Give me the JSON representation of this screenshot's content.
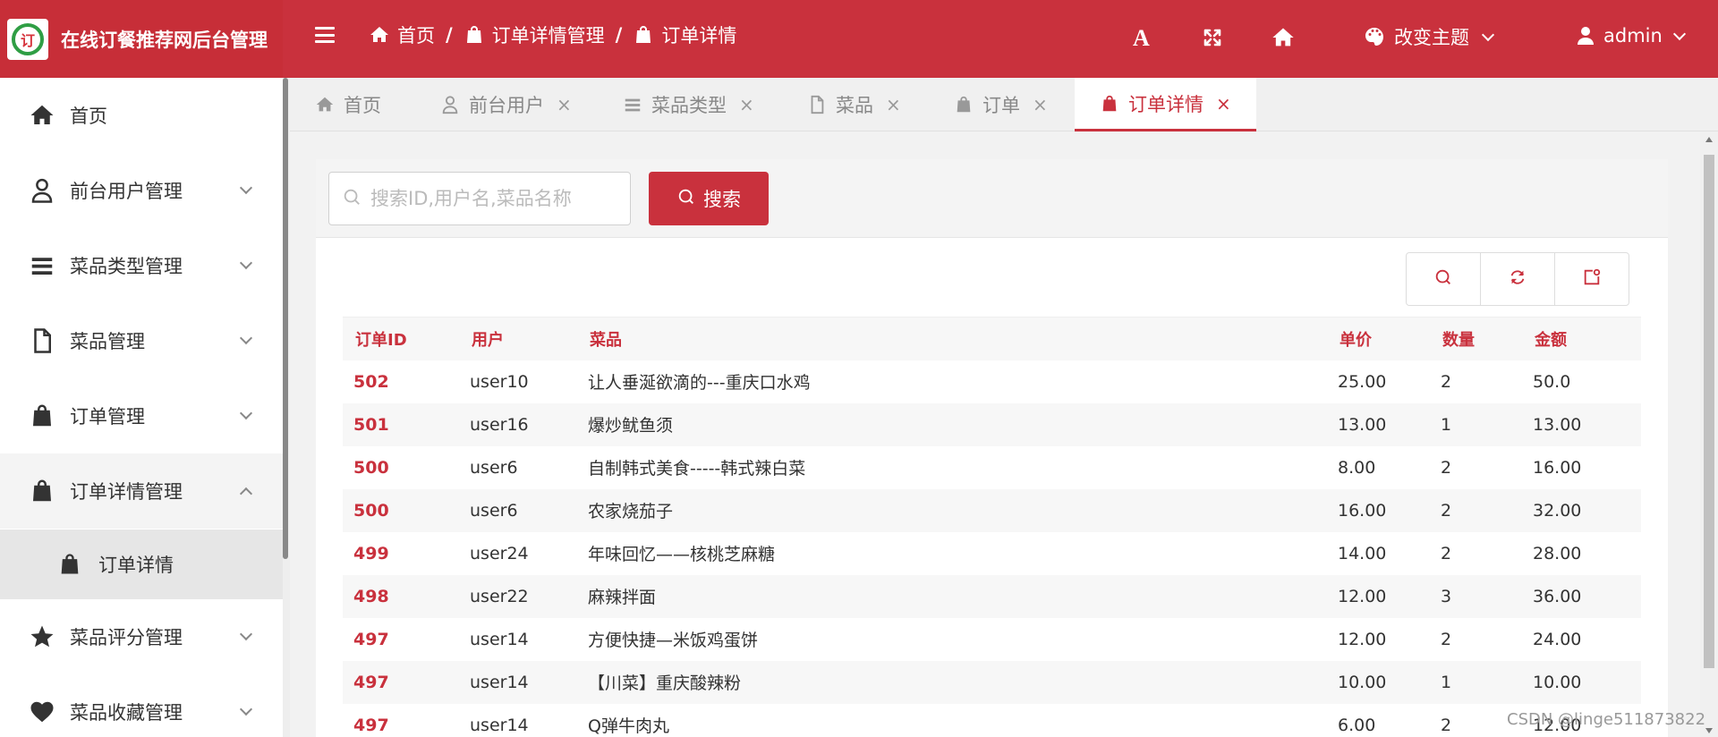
{
  "app": {
    "title": "在线订餐推荐网后台管理"
  },
  "header": {
    "breadcrumb": [
      "首页",
      "订单详情管理",
      "订单详情"
    ],
    "font_button": "A",
    "theme_label": "改变主题",
    "user_label": "admin",
    "accent_color": "#c9313d"
  },
  "sidebar": {
    "items": [
      {
        "label": "首页",
        "icon": "home-icon"
      },
      {
        "label": "前台用户管理",
        "icon": "user-icon"
      },
      {
        "label": "菜品类型管理",
        "icon": "list-icon"
      },
      {
        "label": "菜品管理",
        "icon": "file-icon"
      },
      {
        "label": "订单管理",
        "icon": "bag-icon"
      },
      {
        "label": "订单详情管理",
        "icon": "bag-icon"
      },
      {
        "label": "菜品评分管理",
        "icon": "star-icon"
      },
      {
        "label": "菜品收藏管理",
        "icon": "heart-icon"
      }
    ],
    "sub_item": "订单详情"
  },
  "tabs": [
    {
      "label": "首页"
    },
    {
      "label": "前台用户"
    },
    {
      "label": "菜品类型"
    },
    {
      "label": "菜品"
    },
    {
      "label": "订单"
    },
    {
      "label": "订单详情"
    }
  ],
  "search": {
    "placeholder": "搜索ID,用户名,菜品名称",
    "value": "",
    "button": "搜索"
  },
  "table": {
    "headers": [
      "订单ID",
      "用户",
      "菜品",
      "单价",
      "数量",
      "金额"
    ],
    "rows": [
      [
        "502",
        "user10",
        "让人垂涎欲滴的---重庆口水鸡",
        "25.00",
        "2",
        "50.0"
      ],
      [
        "501",
        "user16",
        "爆炒鱿鱼须",
        "13.00",
        "1",
        "13.00"
      ],
      [
        "500",
        "user6",
        "自制韩式美食-----韩式辣白菜",
        "8.00",
        "2",
        "16.00"
      ],
      [
        "500",
        "user6",
        "农家烧茄子",
        "16.00",
        "2",
        "32.00"
      ],
      [
        "499",
        "user24",
        "年味回忆——核桃芝麻糖",
        "14.00",
        "2",
        "28.00"
      ],
      [
        "498",
        "user22",
        "麻辣拌面",
        "12.00",
        "3",
        "36.00"
      ],
      [
        "497",
        "user14",
        "方便快捷—米饭鸡蛋饼",
        "12.00",
        "2",
        "24.00"
      ],
      [
        "497",
        "user14",
        "【川菜】重庆酸辣粉",
        "10.00",
        "1",
        "10.00"
      ],
      [
        "497",
        "user14",
        "Q弹牛肉丸",
        "6.00",
        "2",
        "12.00"
      ]
    ]
  },
  "watermark": "CSDN @linge511873822"
}
